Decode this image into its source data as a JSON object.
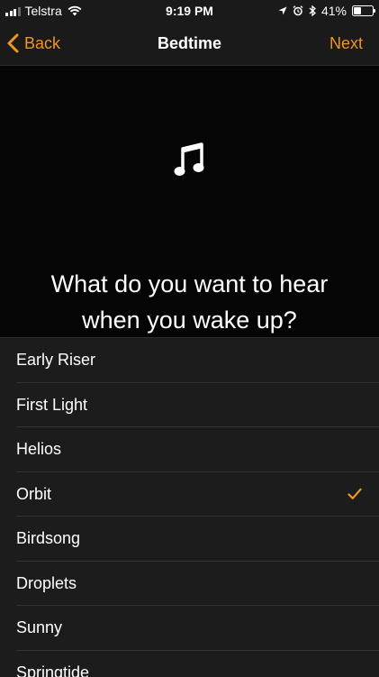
{
  "status_bar": {
    "carrier": "Telstra",
    "time": "9:19 PM",
    "battery_percent": "41%",
    "battery_level": 0.41,
    "icons": [
      "signal-icon",
      "wifi-icon",
      "location-icon",
      "alarm-icon",
      "bluetooth-icon",
      "battery-icon"
    ]
  },
  "nav": {
    "back_label": "Back",
    "title": "Bedtime",
    "next_label": "Next"
  },
  "header": {
    "icon": "music-note-icon",
    "question_line1": "What do you want to hear",
    "question_line2": "when you wake up?"
  },
  "sounds": {
    "items": [
      {
        "label": "Early Riser",
        "selected": false
      },
      {
        "label": "First Light",
        "selected": false
      },
      {
        "label": "Helios",
        "selected": false
      },
      {
        "label": "Orbit",
        "selected": true
      },
      {
        "label": "Birdsong",
        "selected": false
      },
      {
        "label": "Droplets",
        "selected": false
      },
      {
        "label": "Sunny",
        "selected": false
      },
      {
        "label": "Springtide",
        "selected": false
      }
    ]
  },
  "colors": {
    "accent": "#f0961e",
    "background": "#000000",
    "bar": "#1a1a1a",
    "list_background": "#1c1c1c"
  }
}
